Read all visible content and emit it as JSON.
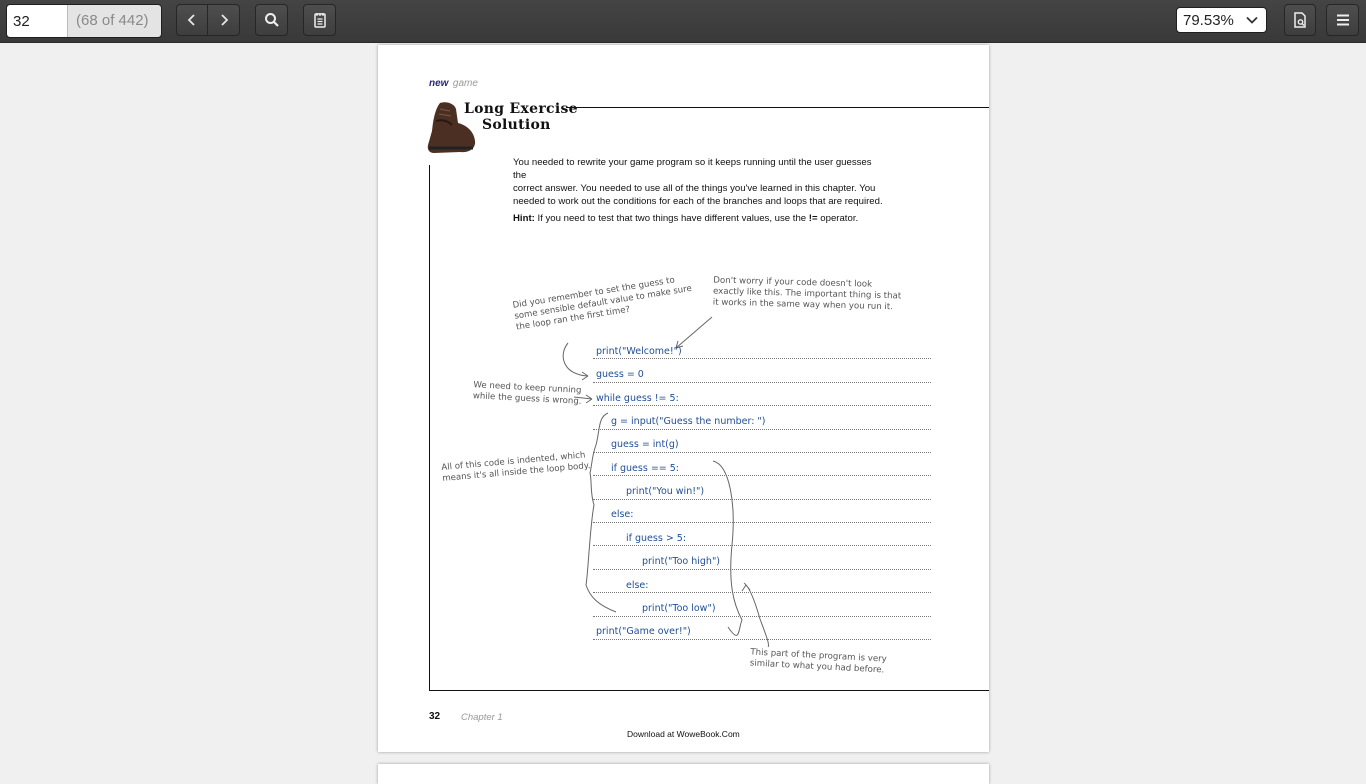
{
  "toolbar": {
    "page_value": "32",
    "page_count": "(68 of 442)",
    "zoom": "79.53%",
    "icons": {
      "prev": "chevron-left-icon",
      "next": "chevron-right-icon",
      "search": "search-icon",
      "annotations": "notes-icon",
      "properties": "document-icon",
      "menu": "hamburger-menu-icon"
    }
  },
  "document": {
    "header_new": "new",
    "header_game": "game",
    "title_line1": "Long Exercise",
    "title_line2": "Solution",
    "intro_line1": "You needed to rewrite your game program so it keeps running until the user guesses the",
    "intro_line2": "correct answer. You needed to use all of the things you've learned in this chapter. You",
    "intro_line3": "needed to work out the conditions for each of the branches and loops that are required.",
    "hint_label": "Hint:",
    "hint_text": " If you need to test that two things have different values, use the ",
    "hint_op": "!=",
    "hint_end": " operator.",
    "annotations": {
      "dont_worry": [
        "Don't worry if your code doesn't look",
        "exactly like this. The important thing is that",
        "it works in the same way when you run it."
      ],
      "remember": [
        "Did you remember to set the guess to",
        "some sensible default value to make sure",
        "the loop ran the first time?"
      ],
      "keep_running": [
        "We need to keep running",
        "while the guess is wrong."
      ],
      "indented": [
        "All of this code is indented, which",
        "means it's all inside the loop body."
      ],
      "similar": [
        "This part of the program is very",
        "similar to what you had before."
      ]
    },
    "code": [
      "print(\"Welcome!\")",
      "guess = 0",
      "while guess != 5:",
      "g = input(\"Guess the number: \")",
      "guess = int(g)",
      "if guess == 5:",
      "print(\"You win!\")",
      "else:",
      "if guess > 5:",
      "print(\"Too high\")",
      "else:",
      "print(\"Too low\")",
      "print(\"Game over!\")"
    ],
    "footer_page": "32",
    "footer_chapter": "Chapter 1",
    "footer_download": "Download at WoweBook.Com"
  }
}
